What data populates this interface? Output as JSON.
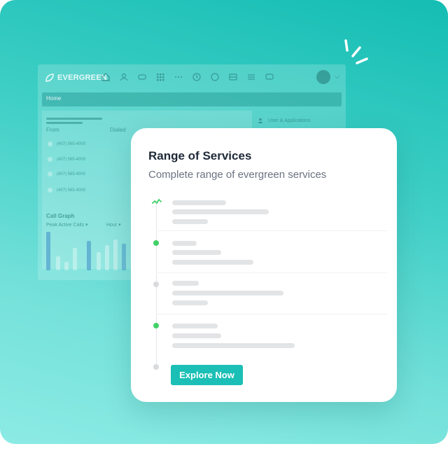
{
  "background_app": {
    "logo_text": "EVERGREEN",
    "breadcrumb": "Home",
    "columns": {
      "from": "From",
      "dialed": "Dialed"
    },
    "phone_numbers": [
      "(407) 565-4000",
      "(407) 565-4000",
      "(407) 565-4000",
      "(407) 565-4000"
    ],
    "users_apps_label": "User & Applications",
    "graph": {
      "title": "Call Graph",
      "metric_filter": "Peak Active Calls ▾",
      "period_filter": "Hour ▾"
    }
  },
  "card": {
    "title": "Range of Services",
    "subtitle": "Complete range of evergreen services",
    "timeline_states": [
      "active",
      "done",
      "pending",
      "done",
      "pending"
    ],
    "cta_label": "Explore Now"
  },
  "colors": {
    "accent": "#1bbfb5",
    "status_green": "#43d068",
    "status_grey": "#d9dadc"
  },
  "icons": [
    "sparkle-icon",
    "home-icon",
    "activity-pulse-icon",
    "avatar-icon",
    "chevron-down-icon"
  ]
}
